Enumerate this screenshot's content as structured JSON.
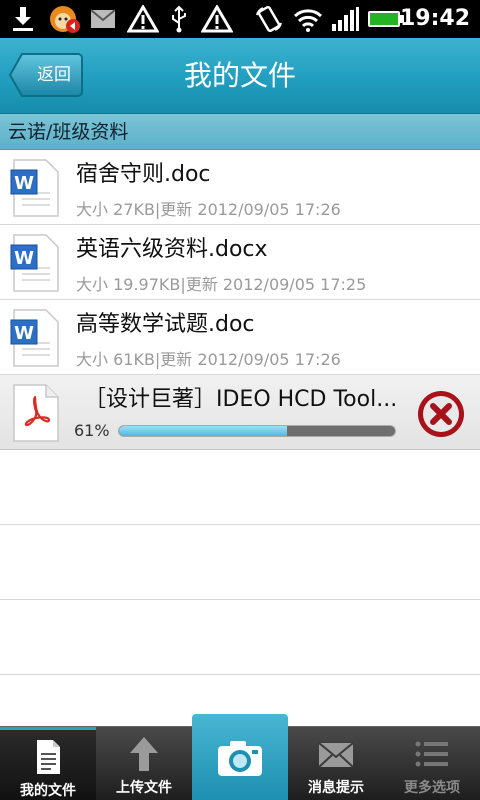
{
  "status_bar": {
    "time": "19:42",
    "icons": [
      "download-icon",
      "avatar-icon",
      "mail-icon",
      "warning-icon",
      "usb-icon",
      "warning-icon",
      "rotate-icon",
      "wifi-icon",
      "signal-icon",
      "battery-icon"
    ]
  },
  "header": {
    "back_label": "返回",
    "title": "我的文件"
  },
  "breadcrumb": "云诺/班级资料",
  "files": [
    {
      "icon": "word-doc-icon",
      "name": "宿舍守则.doc",
      "meta": "大小 27KB|更新 2012/09/05 17:26"
    },
    {
      "icon": "word-doc-icon",
      "name": "英语六级资料.docx",
      "meta": "大小 19.97KB|更新 2012/09/05 17:25"
    },
    {
      "icon": "word-doc-icon",
      "name": "高等数学试题.doc",
      "meta": "大小 61KB|更新 2012/09/05 17:26"
    }
  ],
  "download": {
    "icon": "pdf-icon",
    "name": "［设计巨著］IDEO HCD Tool...",
    "progress_text": "61%",
    "progress": 0.61
  },
  "tabs": [
    {
      "label": "我的文件",
      "icon": "document-icon"
    },
    {
      "label": "上传文件",
      "icon": "upload-arrow-icon"
    },
    {
      "label": "",
      "icon": "camera-icon"
    },
    {
      "label": "消息提示",
      "icon": "envelope-icon"
    },
    {
      "label": "更多选项",
      "icon": "list-icon"
    }
  ],
  "colors": {
    "accent": "#23a0c1",
    "cancel_red": "#a8121b"
  }
}
